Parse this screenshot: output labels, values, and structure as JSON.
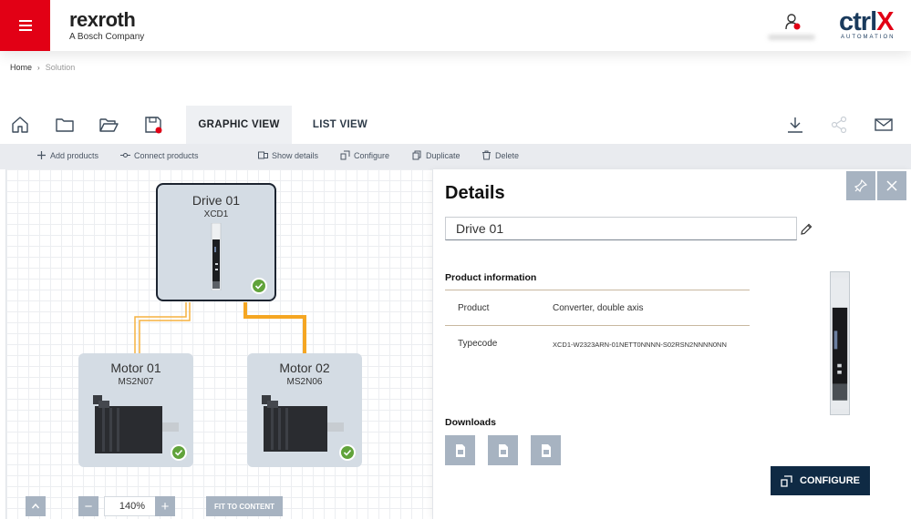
{
  "header": {
    "brand_name": "rexroth",
    "brand_sub": "A Bosch Company",
    "product_logo_main": "ctrl",
    "product_logo_x": "X",
    "product_logo_sub": "AUTOMATION"
  },
  "breadcrumb": {
    "home": "Home",
    "separator": "›",
    "current": "Solution"
  },
  "toolbar": {
    "icons": [
      "home-icon",
      "folder-icon",
      "folder-open-icon",
      "save-icon",
      "download-icon",
      "share-icon",
      "mail-icon"
    ],
    "tabs": [
      {
        "label": "GRAPHIC VIEW",
        "active": true
      },
      {
        "label": "LIST VIEW",
        "active": false
      }
    ]
  },
  "actions": {
    "add_products": "Add products",
    "connect_products": "Connect products",
    "show_details": "Show details",
    "configure": "Configure",
    "duplicate": "Duplicate",
    "delete": "Delete"
  },
  "canvas": {
    "nodes": [
      {
        "title": "Drive 01",
        "sub": "XCD1",
        "selected": true,
        "valid": true
      },
      {
        "title": "Motor 01",
        "sub": "MS2N07",
        "selected": false,
        "valid": true
      },
      {
        "title": "Motor 02",
        "sub": "MS2N06",
        "selected": false,
        "valid": true
      }
    ],
    "wire_color": "#f5a623",
    "zoom_value": "140%",
    "fit_label": "FIT TO CONTENT",
    "minus": "−",
    "plus": "+"
  },
  "details": {
    "title": "Details",
    "name_value": "Drive 01",
    "product_info_title": "Product information",
    "rows": [
      {
        "key": "Product",
        "value": "Converter, double axis"
      },
      {
        "key": "Typecode",
        "value": "XCD1-W2323ARN-01NETT0NNNN-S02RSN2NNNN0NN"
      }
    ],
    "downloads_title": "Downloads",
    "configure_label": "CONFIGURE"
  },
  "colors": {
    "brand_red": "#e20015",
    "dark_navy": "#0f2a44",
    "button_gray": "#a7b3c1",
    "check_green": "#61a33b"
  }
}
